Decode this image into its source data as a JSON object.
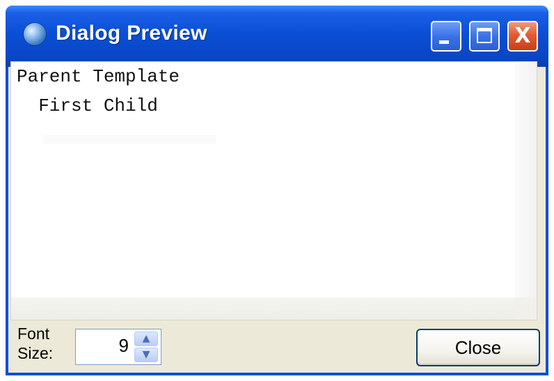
{
  "window": {
    "title": "Dialog Preview",
    "controls": {
      "minimize_icon": "minimize-icon",
      "maximize_icon": "maximize-icon",
      "close_icon": "close-icon",
      "close_glyph": "X"
    }
  },
  "editor": {
    "lines": [
      "Parent Template",
      "  First Child"
    ]
  },
  "footer": {
    "font_label_line1": "Font",
    "font_label_line2": "Size:",
    "font_size_value": "9",
    "close_label": "Close"
  },
  "colors": {
    "titlebar": "#0a4fd6",
    "close_button": "#e35b32",
    "window_background": "#ece9d8"
  }
}
